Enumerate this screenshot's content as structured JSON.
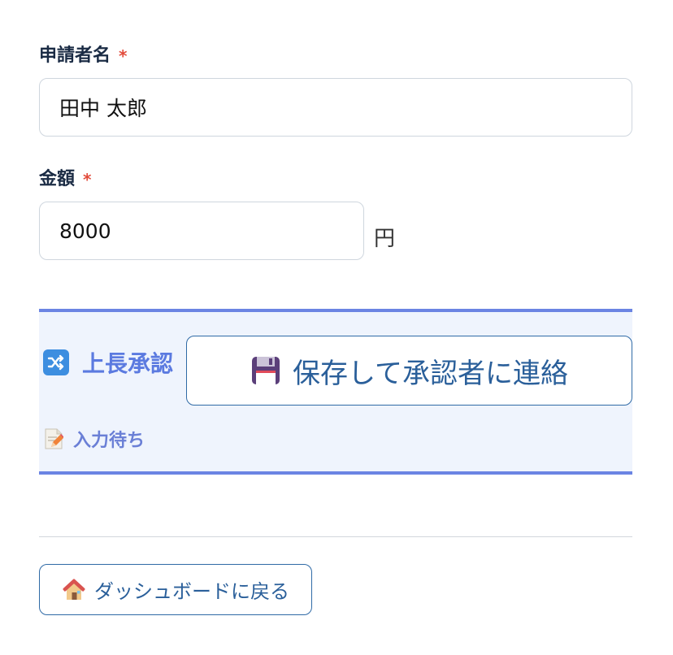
{
  "form": {
    "applicant": {
      "label": "申請者名",
      "required_mark": "*",
      "value": "田中 太郎"
    },
    "amount": {
      "label": "金額",
      "required_mark": "*",
      "value": "8000",
      "unit": "円"
    }
  },
  "approval": {
    "step_icon": "shuffle-icon",
    "step_title": "上長承認",
    "status_icon": "memo-icon",
    "status": "入力待ち"
  },
  "actions": {
    "save_icon": "floppy-disk-icon",
    "save_label": "保存して承認者に連絡",
    "back_icon": "house-icon",
    "back_label": "ダッシュボードに戻る"
  },
  "colors": {
    "accent": "#6b84e3",
    "panel_bg": "#eff4fd",
    "button_text": "#2a5f9a",
    "required": "#e24b3b"
  }
}
